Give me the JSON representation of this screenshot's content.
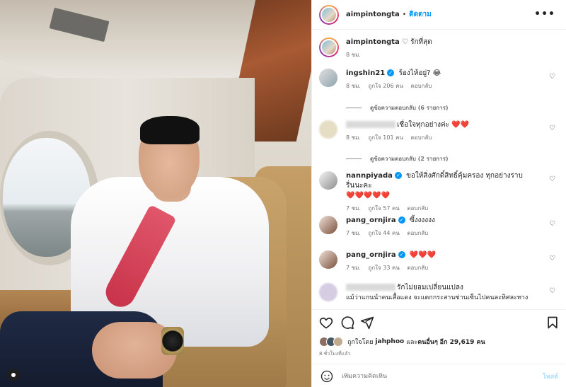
{
  "header": {
    "username": "aimpintongta",
    "separator": "•",
    "follow_label": "ติดตาม",
    "more_label": "•••"
  },
  "caption": {
    "username": "aimpintongta",
    "text": "♡ รักที่สุด",
    "time": "8 ชม."
  },
  "comments": [
    {
      "username": "ingshin21",
      "verified": true,
      "text": "ร้องไห้อยู่? 😂",
      "time": "8 ชม.",
      "likes": "ถูกใจ 206 คน",
      "reply": "ตอบกลับ",
      "view_replies": "ดูข้อความตอบกลับ (6 รายการ)"
    },
    {
      "username": "",
      "verified": false,
      "text": "เชื่อใจทุกอย่างค่ะ",
      "hearts": "❤️❤️",
      "time": "8 ชม.",
      "likes": "ถูกใจ 101 คน",
      "reply": "ตอบกลับ",
      "view_replies": "ดูข้อความตอบกลับ (2 รายการ)"
    },
    {
      "username": "nannpiyada",
      "verified": true,
      "text": "ขอให้สิ่งศักดิ์สิทธิ์คุ้มครอง ทุกอย่างราบรื่นนะคะ",
      "hearts": "❤️❤️❤️❤️❤️",
      "time": "7 ชม.",
      "likes": "ถูกใจ 57 คน",
      "reply": "ตอบกลับ"
    },
    {
      "username": "pang_ornjira",
      "verified": true,
      "text": "ซึ้งงงงงง",
      "time": "7 ชม.",
      "likes": "ถูกใจ 44 คน",
      "reply": "ตอบกลับ"
    },
    {
      "username": "pang_ornjira",
      "verified": true,
      "text": "",
      "hearts": "❤️❤️❤️",
      "time": "7 ชม.",
      "likes": "ถูกใจ 33 คน",
      "reply": "ตอบกลับ"
    },
    {
      "username": "",
      "verified": false,
      "text": "รักไม่ยอมเปลี่ยนแปลง",
      "text2": "แม้ว่าแกนนำคนเสื้อแดง จะแตกกระสานซ่านเซ็นไปคนละทิศละทาง"
    }
  ],
  "actions": {
    "liked_by_prefix": "ถูกใจโดย",
    "liked_by_user": "jahphoo",
    "liked_by_and": "และ",
    "liked_by_others": "คนอื่นๆ",
    "liked_by_more": "อีก 29,619 คน",
    "time": "8 ชั่วโมงที่แล้ว"
  },
  "add_comment": {
    "placeholder": "เพิ่มความคิดเห็น",
    "post_label": "โพสต์"
  },
  "icons": {
    "like": "heart-icon",
    "comment": "comment-icon",
    "share": "share-icon",
    "save": "bookmark-icon",
    "emoji": "emoji-icon",
    "more": "more-icon"
  },
  "colors": {
    "link_blue": "#0095f6",
    "heart_red": "#ed1c3a",
    "muted_text": "#737373",
    "disabled_blue": "#b2dffc"
  }
}
